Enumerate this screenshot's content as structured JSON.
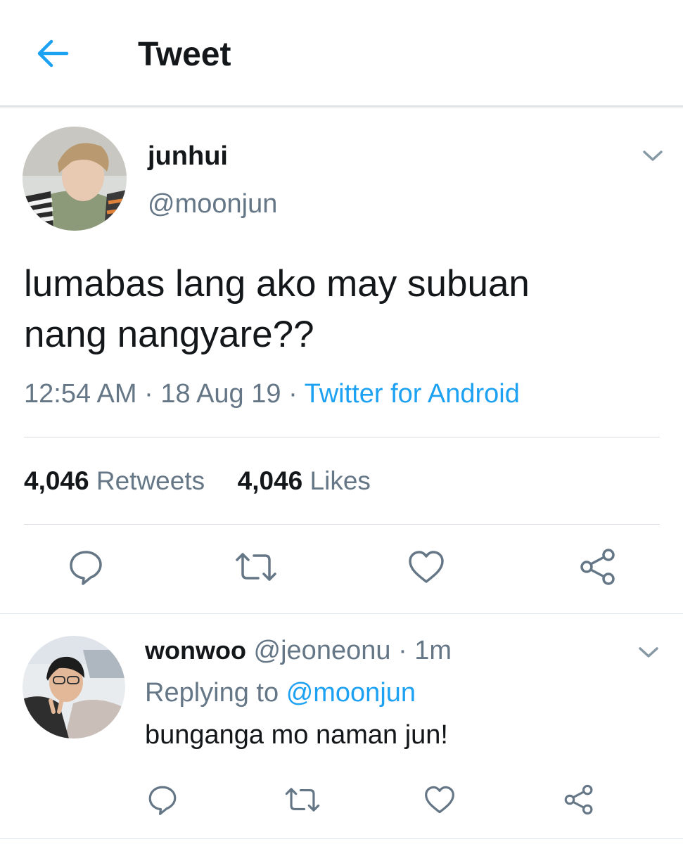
{
  "header": {
    "title": "Tweet",
    "back_icon": "arrow-left-icon"
  },
  "tweet": {
    "author": {
      "name": "junhui",
      "handle": "@moonjun"
    },
    "text_line1": "lumabas lang ako may subuan",
    "text_line2": "nang nangyare??",
    "time": "12:54 AM",
    "sep": "·",
    "date": "18 Aug 19",
    "source": "Twitter for Android",
    "stats": {
      "retweets_count": "4,046",
      "retweets_label": "Retweets",
      "likes_count": "4,046",
      "likes_label": "Likes"
    },
    "actions": [
      "reply-icon",
      "retweet-icon",
      "like-icon",
      "share-icon"
    ]
  },
  "reply": {
    "author": {
      "name": "wonwoo",
      "handle": "@jeoneonu",
      "sep": "·",
      "time": "1m"
    },
    "replying_prefix": "Replying to",
    "replying_to": "@moonjun",
    "text": "bunganga mo naman jun!",
    "actions": [
      "reply-icon",
      "retweet-icon",
      "like-icon",
      "share-icon"
    ]
  },
  "colors": {
    "accent": "#1da1f2",
    "secondary_text": "#657786",
    "primary_text": "#14171a",
    "divider": "#d9dde1"
  }
}
